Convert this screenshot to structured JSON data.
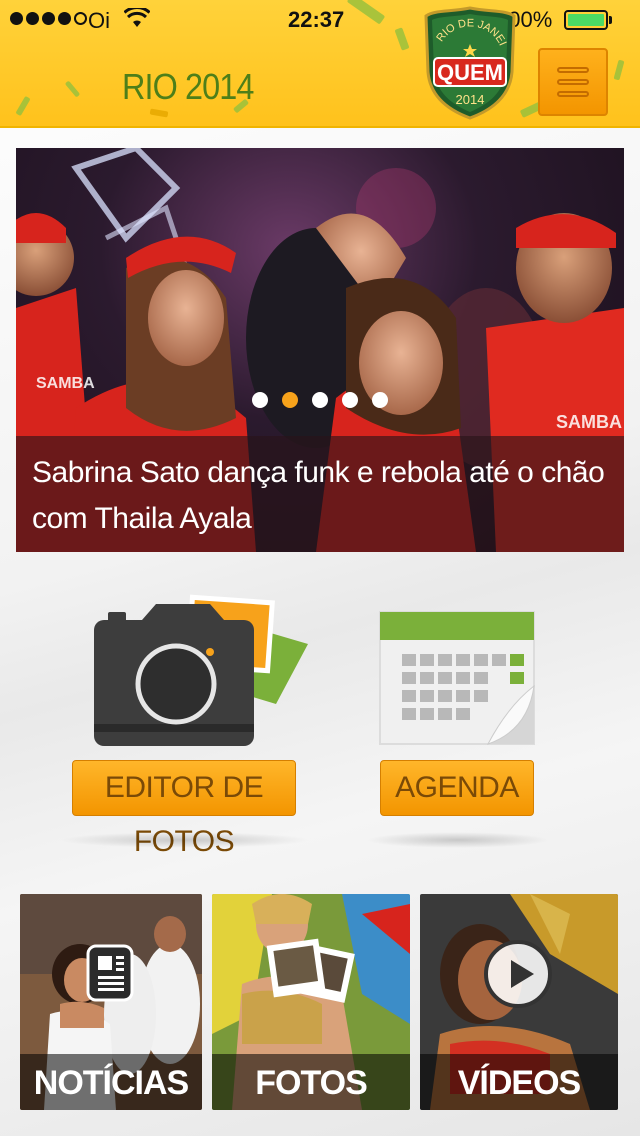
{
  "status_bar": {
    "carrier": "Oi",
    "time": "22:37",
    "battery": "100%"
  },
  "header": {
    "title": "RIO 2014",
    "badge": {
      "arc_text": "RIO DE JANEIRO",
      "brand": "QUEM",
      "year": "2014"
    }
  },
  "carousel": {
    "caption": "Sabrina Sato dança funk e rebola até o chão com Thaila Ayala",
    "slide_count": 5,
    "active_slide": 2
  },
  "features": {
    "editor_label": "EDITOR DE FOTOS",
    "agenda_label": "AGENDA"
  },
  "tiles": [
    {
      "label": "NOTÍCIAS",
      "icon": "newspaper-icon"
    },
    {
      "label": "FOTOS",
      "icon": "photos-icon"
    },
    {
      "label": "VÍDEOS",
      "icon": "play-icon"
    }
  ],
  "colors": {
    "header_yellow": "#ffc21c",
    "title_green": "#4e7f19",
    "accent_orange": "#f39500",
    "active_dot": "#f7a21b"
  }
}
